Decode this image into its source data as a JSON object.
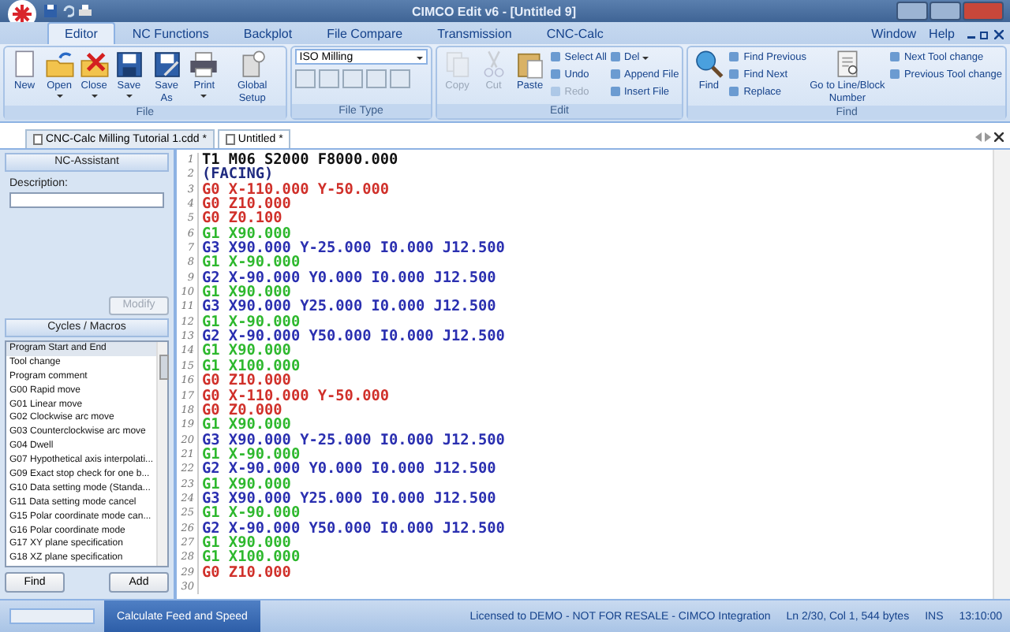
{
  "window": {
    "title": "CIMCO Edit v6 - [Untitled 9]"
  },
  "ribbon_tabs": [
    {
      "label": "Editor",
      "selected": true
    },
    {
      "label": "NC Functions",
      "selected": false
    },
    {
      "label": "Backplot",
      "selected": false
    },
    {
      "label": "File Compare",
      "selected": false
    },
    {
      "label": "Transmission",
      "selected": false
    },
    {
      "label": "CNC-Calc",
      "selected": false
    }
  ],
  "menu_right": [
    "Window",
    "Help"
  ],
  "ribbon_groups": [
    {
      "title": "File",
      "buttons": [
        {
          "kind": "big",
          "label": "New",
          "disabled": false,
          "dropdown": false
        },
        {
          "kind": "big",
          "label": "Open",
          "disabled": false,
          "dropdown": true
        },
        {
          "kind": "big",
          "label": "Close",
          "disabled": false,
          "dropdown": true
        },
        {
          "kind": "big",
          "label": "Save",
          "disabled": false,
          "dropdown": true
        },
        {
          "kind": "big",
          "label": "Save As",
          "disabled": false,
          "dropdown": false
        },
        {
          "kind": "big",
          "label": "Print",
          "disabled": false,
          "dropdown": true
        },
        {
          "kind": "big",
          "label": "Global Setup",
          "disabled": false,
          "dropdown": false
        }
      ]
    },
    {
      "title": "File Type",
      "buttons": [
        {
          "kind": "select",
          "label": "ISO Milling",
          "disabled": false,
          "dropdown": true
        }
      ]
    },
    {
      "title": "Edit",
      "buttons": [
        {
          "kind": "big",
          "label": "Copy",
          "disabled": true,
          "dropdown": false
        },
        {
          "kind": "big",
          "label": "Cut",
          "disabled": true,
          "dropdown": false
        },
        {
          "kind": "big",
          "label": "Paste",
          "disabled": false,
          "dropdown": false
        },
        {
          "kind": "small",
          "label": "Select All",
          "disabled": false,
          "dropdown": false
        },
        {
          "kind": "small",
          "label": "Undo",
          "disabled": false,
          "dropdown": false
        },
        {
          "kind": "small",
          "label": "Redo",
          "disabled": true,
          "dropdown": false
        },
        {
          "kind": "small",
          "label": "Del",
          "disabled": false,
          "dropdown": true
        },
        {
          "kind": "small",
          "label": "Append File",
          "disabled": false,
          "dropdown": false
        },
        {
          "kind": "small",
          "label": "Insert File",
          "disabled": false,
          "dropdown": false
        }
      ]
    },
    {
      "title": "Find",
      "buttons": [
        {
          "kind": "big",
          "label": "Find",
          "disabled": false,
          "dropdown": false
        },
        {
          "kind": "small",
          "label": "Find Previous",
          "disabled": false,
          "dropdown": false
        },
        {
          "kind": "small",
          "label": "Find Next",
          "disabled": false,
          "dropdown": false
        },
        {
          "kind": "small",
          "label": "Replace",
          "disabled": false,
          "dropdown": false
        },
        {
          "kind": "big",
          "label": "Go to Line/Block Number",
          "disabled": false,
          "dropdown": false
        },
        {
          "kind": "small",
          "label": "Next Tool change",
          "disabled": false,
          "dropdown": false
        },
        {
          "kind": "small",
          "label": "Previous Tool change",
          "disabled": false,
          "dropdown": false
        }
      ]
    }
  ],
  "documents": [
    {
      "label": "CNC-Calc Milling Tutorial 1.cdd *",
      "selected": false
    },
    {
      "label": "Untitled *",
      "selected": true
    }
  ],
  "nc_assistant": {
    "title": "NC-Assistant",
    "description_label": "Description:",
    "modify_button": {
      "label": "Modify",
      "disabled": true
    }
  },
  "cycles": {
    "title": "Cycles / Macros",
    "items": [
      {
        "label": "Program Start and End",
        "selected": true
      },
      {
        "label": "Tool change",
        "selected": false
      },
      {
        "label": "Program comment",
        "selected": false
      },
      {
        "label": "G00 Rapid move",
        "selected": false
      },
      {
        "label": "G01 Linear move",
        "selected": false
      },
      {
        "label": "G02 Clockwise arc move",
        "selected": false
      },
      {
        "label": "G03 Counterclockwise arc move",
        "selected": false
      },
      {
        "label": "G04 Dwell",
        "selected": false
      },
      {
        "label": "G07 Hypothetical axis interpolati...",
        "selected": false
      },
      {
        "label": "G09 Exact stop check for one b...",
        "selected": false
      },
      {
        "label": "G10 Data setting mode (Standa...",
        "selected": false
      },
      {
        "label": "G11 Data setting mode cancel",
        "selected": false
      },
      {
        "label": "G15 Polar coordinate mode can...",
        "selected": false
      },
      {
        "label": "G16 Polar coordinate mode",
        "selected": false
      },
      {
        "label": "G17 XY plane specification",
        "selected": false
      },
      {
        "label": "G18 XZ plane specification",
        "selected": false
      }
    ],
    "buttons": [
      "Find",
      "Add"
    ]
  },
  "editor": {
    "lines": [
      {
        "number": "1",
        "kind": "plain",
        "code": "T1 M06 S2000 F8000.000"
      },
      {
        "number": "2",
        "kind": "comment",
        "code": "(FACING)"
      },
      {
        "number": "3",
        "kind": "rapid",
        "code": "G0 X-110.000 Y-50.000"
      },
      {
        "number": "4",
        "kind": "rapid",
        "code": "G0 Z10.000"
      },
      {
        "number": "5",
        "kind": "rapid",
        "code": "G0 Z0.100"
      },
      {
        "number": "6",
        "kind": "linear",
        "code": "G1 X90.000"
      },
      {
        "number": "7",
        "kind": "arc",
        "code": "G3 X90.000 Y-25.000 I0.000 J12.500"
      },
      {
        "number": "8",
        "kind": "linear",
        "code": "G1 X-90.000"
      },
      {
        "number": "9",
        "kind": "arc",
        "code": "G2 X-90.000 Y0.000 I0.000 J12.500"
      },
      {
        "number": "10",
        "kind": "linear",
        "code": "G1 X90.000"
      },
      {
        "number": "11",
        "kind": "arc",
        "code": "G3 X90.000 Y25.000 I0.000 J12.500"
      },
      {
        "number": "12",
        "kind": "linear",
        "code": "G1 X-90.000"
      },
      {
        "number": "13",
        "kind": "arc",
        "code": "G2 X-90.000 Y50.000 I0.000 J12.500"
      },
      {
        "number": "14",
        "kind": "linear",
        "code": "G1 X90.000"
      },
      {
        "number": "15",
        "kind": "linear",
        "code": "G1 X100.000"
      },
      {
        "number": "16",
        "kind": "rapid",
        "code": "G0 Z10.000"
      },
      {
        "number": "17",
        "kind": "rapid",
        "code": "G0 X-110.000 Y-50.000"
      },
      {
        "number": "18",
        "kind": "rapid",
        "code": "G0 Z0.000"
      },
      {
        "number": "19",
        "kind": "linear",
        "code": "G1 X90.000"
      },
      {
        "number": "20",
        "kind": "arc",
        "code": "G3 X90.000 Y-25.000 I0.000 J12.500"
      },
      {
        "number": "21",
        "kind": "linear",
        "code": "G1 X-90.000"
      },
      {
        "number": "22",
        "kind": "arc",
        "code": "G2 X-90.000 Y0.000 I0.000 J12.500"
      },
      {
        "number": "23",
        "kind": "linear",
        "code": "G1 X90.000"
      },
      {
        "number": "24",
        "kind": "arc",
        "code": "G3 X90.000 Y25.000 I0.000 J12.500"
      },
      {
        "number": "25",
        "kind": "linear",
        "code": "G1 X-90.000"
      },
      {
        "number": "26",
        "kind": "arc",
        "code": "G2 X-90.000 Y50.000 I0.000 J12.500"
      },
      {
        "number": "27",
        "kind": "linear",
        "code": "G1 X90.000"
      },
      {
        "number": "28",
        "kind": "linear",
        "code": "G1 X100.000"
      },
      {
        "number": "29",
        "kind": "rapid",
        "code": "G0 Z10.000"
      },
      {
        "number": "30"
      }
    ]
  },
  "status_bar": {
    "action": "Calculate Feed and Speed",
    "license": "Licensed to DEMO - NOT FOR RESALE - CIMCO Integration",
    "position": "Ln 2/30, Col 1, 544 bytes",
    "mode": "INS",
    "time": "13:10:00"
  }
}
